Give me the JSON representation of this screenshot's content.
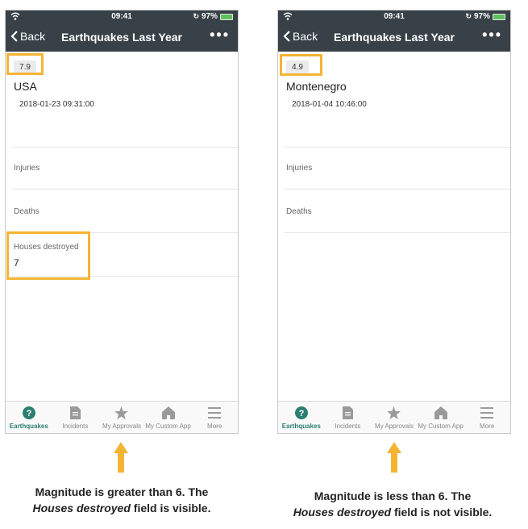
{
  "phones": [
    {
      "status": {
        "time": "09:41",
        "battery": "97%"
      },
      "nav": {
        "back": "Back",
        "title": "Earthquakes Last Year"
      },
      "record": {
        "magnitude": "7.9",
        "place": "USA",
        "datetime": "2018-01-23 09:31:00",
        "injuries_label": "Injuries",
        "deaths_label": "Deaths",
        "houses_label": "Houses destroyed",
        "houses_value": "7"
      }
    },
    {
      "status": {
        "time": "09:41",
        "battery": "97%"
      },
      "nav": {
        "back": "Back",
        "title": "Earthquakes Last Year"
      },
      "record": {
        "magnitude": "4.9",
        "place": "Montenegro",
        "datetime": "2018-01-04 10:46:00",
        "injuries_label": "Injuries",
        "deaths_label": "Deaths"
      }
    }
  ],
  "tabs": [
    {
      "label": "Earthquakes",
      "icon": "question-icon",
      "active": true
    },
    {
      "label": "Incidents",
      "icon": "document-icon",
      "active": false
    },
    {
      "label": "My Approvals",
      "icon": "star-icon",
      "active": false
    },
    {
      "label": "My Custom App",
      "icon": "home-icon",
      "active": false
    },
    {
      "label": "More",
      "icon": "menu-icon",
      "active": false
    }
  ],
  "captions": {
    "left_line1": "Magnitude is greater than 6.  The",
    "left_italic": "Houses destroyed",
    "left_line2_rest": " field is visible.",
    "right_line1": "Magnitude is less than 6.  The",
    "right_italic": "Houses destroyed",
    "right_line2_rest": " field is not visible."
  },
  "colors": {
    "header": "#384147",
    "highlight": "#f5b433",
    "active_tab": "#2a7f71",
    "battery": "#5ec15e"
  }
}
